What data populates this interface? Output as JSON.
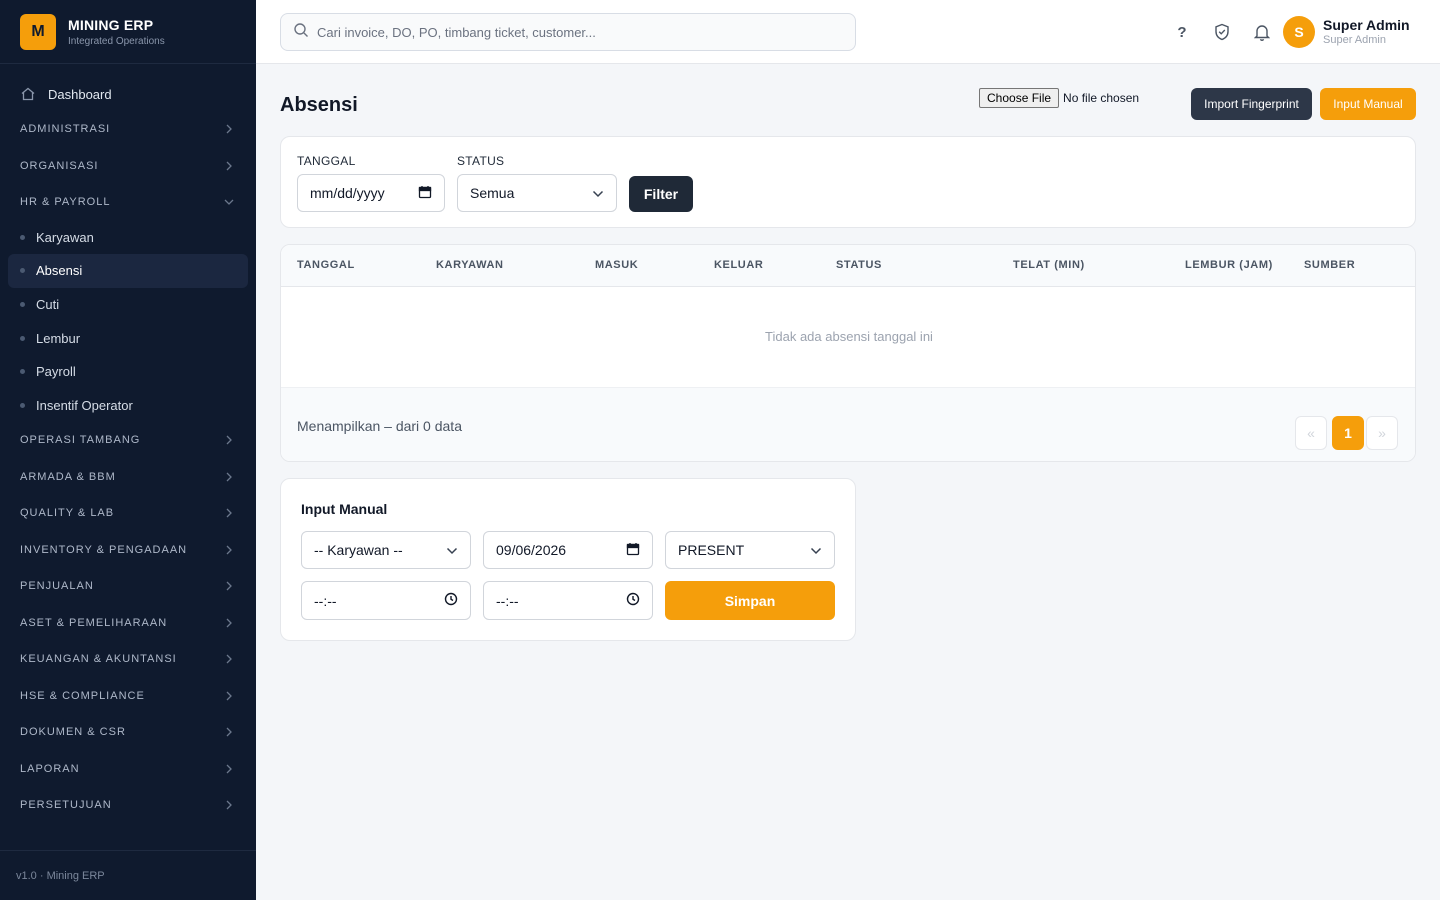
{
  "brand": {
    "logo_letter": "M",
    "title": "MINING ERP",
    "subtitle": "Integrated Operations"
  },
  "sidebar": {
    "dashboard": {
      "label": "Dashboard",
      "icon": "home-icon"
    },
    "sections_before": [
      {
        "label": "ADMINISTRASI"
      },
      {
        "label": "ORGANISASI"
      }
    ],
    "hr_section": {
      "label": "HR & PAYROLL",
      "expanded": true
    },
    "hr_items": [
      {
        "label": "Karyawan",
        "active": false
      },
      {
        "label": "Absensi",
        "active": true
      },
      {
        "label": "Cuti",
        "active": false
      },
      {
        "label": "Lembur",
        "active": false
      },
      {
        "label": "Payroll",
        "active": false
      },
      {
        "label": "Insentif Operator",
        "active": false
      }
    ],
    "sections_after": [
      {
        "label": "OPERASI TAMBANG"
      },
      {
        "label": "ARMADA & BBM"
      },
      {
        "label": "QUALITY & LAB"
      },
      {
        "label": "INVENTORY & PENGADAAN"
      },
      {
        "label": "PENJUALAN"
      },
      {
        "label": "ASET & PEMELIHARAAN"
      },
      {
        "label": "KEUANGAN & AKUNTANSI"
      },
      {
        "label": "HSE & COMPLIANCE"
      },
      {
        "label": "DOKUMEN & CSR"
      },
      {
        "label": "LAPORAN"
      },
      {
        "label": "PERSETUJUAN"
      }
    ],
    "footer": "v1.0 · Mining ERP"
  },
  "topbar": {
    "search_placeholder": "Cari invoice, DO, PO, timbang ticket, customer...",
    "help": "?",
    "user_initial": "S",
    "user_name": "Super Admin",
    "user_role": "Super Admin"
  },
  "page": {
    "title": "Absensi",
    "file_button": "Choose File",
    "file_label": "No file chosen",
    "import_button": "Import Fingerprint",
    "manual_button": "Input Manual"
  },
  "filter": {
    "date_label": "TANGGAL",
    "date_value": "mm/dd/yyyy",
    "status_label": "STATUS",
    "status_value": "Semua",
    "button": "Filter"
  },
  "table": {
    "columns": [
      "TANGGAL",
      "KARYAWAN",
      "MASUK",
      "KELUAR",
      "STATUS",
      "TELAT (MIN)",
      "LEMBUR (JAM)",
      "SUMBER"
    ],
    "empty_text": "Tidak ada absensi tanggal ini",
    "footer_info": "Menampilkan – dari 0 data",
    "pagination": {
      "prev": "«",
      "current": "1",
      "next": "»"
    }
  },
  "manual_form": {
    "title": "Input Manual",
    "employee_value": "-- Karyawan --",
    "date_value": "09/06/2026",
    "status_value": "PRESENT",
    "time_in_value": "--:--",
    "time_out_value": "--:--",
    "submit": "Simpan"
  },
  "colors": {
    "sidebar_bg": "#0f1a2e",
    "accent": "#f59e0b",
    "dark_button": "#2d3748"
  }
}
